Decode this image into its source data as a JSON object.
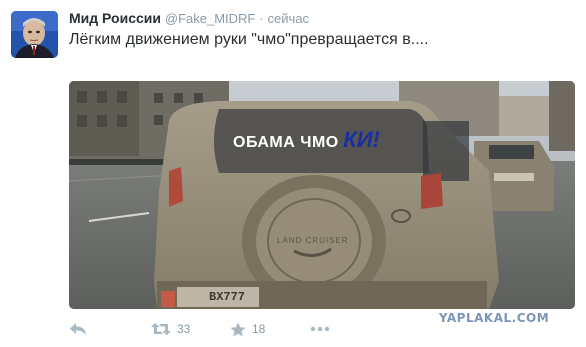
{
  "tweet": {
    "author_name": "Мид Роиссии",
    "author_handle": "@Fake_MIDRF",
    "separator": "·",
    "time": "сейчас",
    "text": "Лёгким движением руки \"чмо\"превращается в....",
    "image_text": {
      "line_main": "ОБАМА ЧМО",
      "line_add": "КИ!",
      "spare_wheel_brand": "LAND CRUISER",
      "plate": "ВХ777"
    },
    "actions": {
      "reply_icon": "reply-icon",
      "retweet_icon": "retweet-icon",
      "retweet_count": "33",
      "favorite_icon": "star-icon",
      "favorite_count": "18",
      "more_icon": "more-icon"
    }
  },
  "watermark": "YAPLAKAL.COM",
  "colors": {
    "name": "#292f33",
    "meta": "#8899a6",
    "watermark": "#7d95b8",
    "handwriting": "#1a2fa3"
  }
}
